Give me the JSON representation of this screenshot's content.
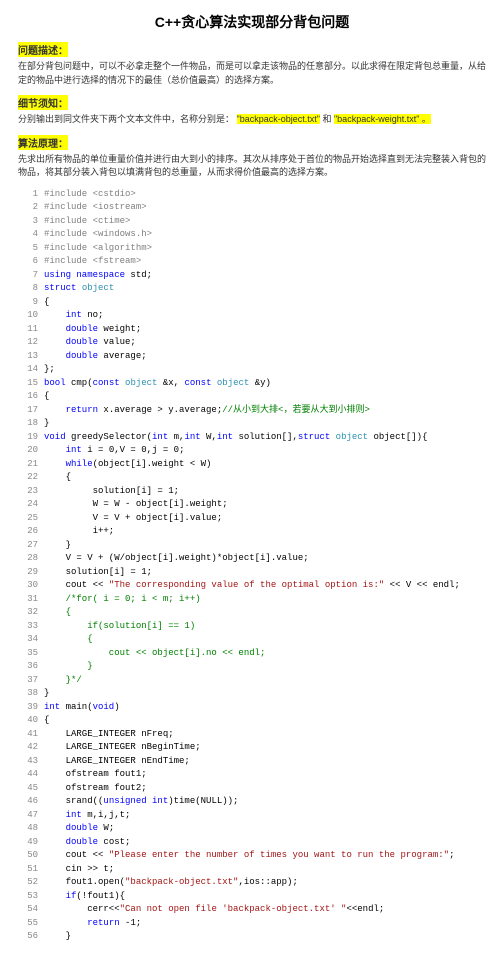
{
  "title": "C++贪心算法实现部分背包问题",
  "s1_h": "问题描述：",
  "s1_p": "在部分背包问题中，可以不必拿走整个一件物品，而是可以拿走该物品的任意部分。以此求得在限定背包总重量，从给定的物品中进行选择的情况下的最佳（总价值最高）的选择方案。",
  "s2_h": "细节须知：",
  "s2_p1": "分别输出到同文件夹下两个文本文件中，名称分别是：",
  "s2_hl1": "\"backpack-object.txt\"",
  "s2_mid": " 和 ",
  "s2_hl2": "\"backpack-weight.txt\" 。",
  "s3_h": "算法原理：",
  "s3_p": "先求出所有物品的单位重量价值并进行由大到小的排序。其次从排序处于首位的物品开始选择直到无法完整装入背包的物品，将其部分装入背包以填满背包的总重量，从而求得价值最高的选择方案。",
  "code": [
    {
      "n": "1",
      "c": [
        {
          "t": "#include <cstdio>",
          "k": "pp"
        }
      ]
    },
    {
      "n": "2",
      "c": [
        {
          "t": "#include <iostream>",
          "k": "pp"
        }
      ]
    },
    {
      "n": "3",
      "c": [
        {
          "t": "#include <ctime>",
          "k": "pp"
        }
      ]
    },
    {
      "n": "4",
      "c": [
        {
          "t": "#include <windows.h>",
          "k": "pp"
        }
      ]
    },
    {
      "n": "5",
      "c": [
        {
          "t": "#include <algorithm>",
          "k": "pp"
        }
      ]
    },
    {
      "n": "6",
      "c": [
        {
          "t": "#include <fstream>",
          "k": "pp"
        }
      ]
    },
    {
      "n": "7",
      "c": [
        {
          "t": "using namespace",
          "k": "kw"
        },
        {
          "t": " std;",
          "k": "id"
        }
      ]
    },
    {
      "n": "8",
      "c": [
        {
          "t": "struct",
          "k": "kw"
        },
        {
          "t": " ",
          "k": "id"
        },
        {
          "t": "object",
          "k": "tp"
        }
      ]
    },
    {
      "n": "9",
      "c": [
        {
          "t": "{",
          "k": "id"
        }
      ]
    },
    {
      "n": "10",
      "c": [
        {
          "t": "    ",
          "k": "id"
        },
        {
          "t": "int",
          "k": "kw"
        },
        {
          "t": " no;",
          "k": "id"
        }
      ]
    },
    {
      "n": "11",
      "c": [
        {
          "t": "    ",
          "k": "id"
        },
        {
          "t": "double",
          "k": "kw"
        },
        {
          "t": " weight;",
          "k": "id"
        }
      ]
    },
    {
      "n": "12",
      "c": [
        {
          "t": "    ",
          "k": "id"
        },
        {
          "t": "double",
          "k": "kw"
        },
        {
          "t": " value;",
          "k": "id"
        }
      ]
    },
    {
      "n": "13",
      "c": [
        {
          "t": "    ",
          "k": "id"
        },
        {
          "t": "double",
          "k": "kw"
        },
        {
          "t": " average;",
          "k": "id"
        }
      ]
    },
    {
      "n": "14",
      "c": [
        {
          "t": "};",
          "k": "id"
        }
      ]
    },
    {
      "n": "15",
      "c": [
        {
          "t": "bool",
          "k": "kw"
        },
        {
          "t": " cmp(",
          "k": "id"
        },
        {
          "t": "const",
          "k": "kw"
        },
        {
          "t": " ",
          "k": "id"
        },
        {
          "t": "object",
          "k": "tp"
        },
        {
          "t": " &x, ",
          "k": "id"
        },
        {
          "t": "const",
          "k": "kw"
        },
        {
          "t": " ",
          "k": "id"
        },
        {
          "t": "object",
          "k": "tp"
        },
        {
          "t": " &y)",
          "k": "id"
        }
      ]
    },
    {
      "n": "16",
      "c": [
        {
          "t": "{",
          "k": "id"
        }
      ]
    },
    {
      "n": "17",
      "c": [
        {
          "t": "    ",
          "k": "id"
        },
        {
          "t": "return",
          "k": "kw"
        },
        {
          "t": " x.average > y.average;",
          "k": "id"
        },
        {
          "t": "//从小到大排<，若要从大到小排则>",
          "k": "cm"
        }
      ]
    },
    {
      "n": "18",
      "c": [
        {
          "t": "}",
          "k": "id"
        }
      ]
    },
    {
      "n": "19",
      "c": [
        {
          "t": "void",
          "k": "kw"
        },
        {
          "t": " greedySelector(",
          "k": "id"
        },
        {
          "t": "int",
          "k": "kw"
        },
        {
          "t": " m,",
          "k": "id"
        },
        {
          "t": "int",
          "k": "kw"
        },
        {
          "t": " W,",
          "k": "id"
        },
        {
          "t": "int",
          "k": "kw"
        },
        {
          "t": " solution[],",
          "k": "id"
        },
        {
          "t": "struct",
          "k": "kw"
        },
        {
          "t": " ",
          "k": "id"
        },
        {
          "t": "object",
          "k": "tp"
        },
        {
          "t": " object[]){",
          "k": "id"
        }
      ]
    },
    {
      "n": "20",
      "c": [
        {
          "t": "    ",
          "k": "id"
        },
        {
          "t": "int",
          "k": "kw"
        },
        {
          "t": " i = ",
          "k": "id"
        },
        {
          "t": "0",
          "k": "num"
        },
        {
          "t": ",V = ",
          "k": "id"
        },
        {
          "t": "0",
          "k": "num"
        },
        {
          "t": ",j = ",
          "k": "id"
        },
        {
          "t": "0",
          "k": "num"
        },
        {
          "t": ";",
          "k": "id"
        }
      ]
    },
    {
      "n": "21",
      "c": [
        {
          "t": "    ",
          "k": "id"
        },
        {
          "t": "while",
          "k": "kw"
        },
        {
          "t": "(object[i].weight < W)",
          "k": "id"
        }
      ]
    },
    {
      "n": "22",
      "c": [
        {
          "t": "    {",
          "k": "id"
        }
      ]
    },
    {
      "n": "23",
      "c": [
        {
          "t": "         solution[i] = ",
          "k": "id"
        },
        {
          "t": "1",
          "k": "num"
        },
        {
          "t": ";",
          "k": "id"
        }
      ]
    },
    {
      "n": "24",
      "c": [
        {
          "t": "         W = W - object[i].weight;",
          "k": "id"
        }
      ]
    },
    {
      "n": "25",
      "c": [
        {
          "t": "         V = V + object[i].value;",
          "k": "id"
        }
      ]
    },
    {
      "n": "26",
      "c": [
        {
          "t": "         i++;",
          "k": "id"
        }
      ]
    },
    {
      "n": "27",
      "c": [
        {
          "t": "    }",
          "k": "id"
        }
      ]
    },
    {
      "n": "28",
      "c": [
        {
          "t": "    V = V + (W/object[i].weight)*object[i].value;",
          "k": "id"
        }
      ]
    },
    {
      "n": "29",
      "c": [
        {
          "t": "    solution[i] = ",
          "k": "id"
        },
        {
          "t": "1",
          "k": "num"
        },
        {
          "t": ";",
          "k": "id"
        }
      ]
    },
    {
      "n": "30",
      "c": [
        {
          "t": "    cout << ",
          "k": "id"
        },
        {
          "t": "\"The corresponding value of the optimal option is:\"",
          "k": "str"
        },
        {
          "t": " << V << endl;",
          "k": "id"
        }
      ]
    },
    {
      "n": "31",
      "c": [
        {
          "t": "    ",
          "k": "id"
        },
        {
          "t": "/*for( i = 0; i < m; i++)",
          "k": "cm"
        }
      ]
    },
    {
      "n": "32",
      "c": [
        {
          "t": "    {",
          "k": "cm"
        }
      ]
    },
    {
      "n": "33",
      "c": [
        {
          "t": "        if(solution[i] == 1)",
          "k": "cm"
        }
      ]
    },
    {
      "n": "34",
      "c": [
        {
          "t": "        {",
          "k": "cm"
        }
      ]
    },
    {
      "n": "35",
      "c": [
        {
          "t": "            cout << object[i].no << endl;",
          "k": "cm"
        }
      ]
    },
    {
      "n": "36",
      "c": [
        {
          "t": "        }",
          "k": "cm"
        }
      ]
    },
    {
      "n": "37",
      "c": [
        {
          "t": "    }*/",
          "k": "cm"
        }
      ]
    },
    {
      "n": "38",
      "c": [
        {
          "t": "}",
          "k": "id"
        }
      ]
    },
    {
      "n": "39",
      "c": [
        {
          "t": "int",
          "k": "kw"
        },
        {
          "t": " main(",
          "k": "id"
        },
        {
          "t": "void",
          "k": "kw"
        },
        {
          "t": ")",
          "k": "id"
        }
      ]
    },
    {
      "n": "40",
      "c": [
        {
          "t": "{",
          "k": "id"
        }
      ]
    },
    {
      "n": "41",
      "c": [
        {
          "t": "    LARGE_INTEGER nFreq;",
          "k": "id"
        }
      ]
    },
    {
      "n": "42",
      "c": [
        {
          "t": "    LARGE_INTEGER nBeginTime;",
          "k": "id"
        }
      ]
    },
    {
      "n": "43",
      "c": [
        {
          "t": "    LARGE_INTEGER nEndTime;",
          "k": "id"
        }
      ]
    },
    {
      "n": "44",
      "c": [
        {
          "t": "    ofstream fout1;",
          "k": "id"
        }
      ]
    },
    {
      "n": "45",
      "c": [
        {
          "t": "    ofstream fout2;",
          "k": "id"
        }
      ]
    },
    {
      "n": "46",
      "c": [
        {
          "t": "    srand((",
          "k": "id"
        },
        {
          "t": "unsigned int",
          "k": "kw"
        },
        {
          "t": ")time(NULL));",
          "k": "id"
        }
      ]
    },
    {
      "n": "47",
      "c": [
        {
          "t": "    ",
          "k": "id"
        },
        {
          "t": "int",
          "k": "kw"
        },
        {
          "t": " m,i,j,t;",
          "k": "id"
        }
      ]
    },
    {
      "n": "48",
      "c": [
        {
          "t": "    ",
          "k": "id"
        },
        {
          "t": "double",
          "k": "kw"
        },
        {
          "t": " W;",
          "k": "id"
        }
      ]
    },
    {
      "n": "49",
      "c": [
        {
          "t": "    ",
          "k": "id"
        },
        {
          "t": "double",
          "k": "kw"
        },
        {
          "t": " cost;",
          "k": "id"
        }
      ]
    },
    {
      "n": "50",
      "c": [
        {
          "t": "    cout << ",
          "k": "id"
        },
        {
          "t": "\"Please enter the number of times you want to run the program:\"",
          "k": "str"
        },
        {
          "t": ";",
          "k": "id"
        }
      ]
    },
    {
      "n": "51",
      "c": [
        {
          "t": "    cin >> t;",
          "k": "id"
        }
      ]
    },
    {
      "n": "52",
      "c": [
        {
          "t": "    fout1.open(",
          "k": "id"
        },
        {
          "t": "\"backpack-object.txt\"",
          "k": "str"
        },
        {
          "t": ",ios::app);",
          "k": "id"
        }
      ]
    },
    {
      "n": "53",
      "c": [
        {
          "t": "    ",
          "k": "id"
        },
        {
          "t": "if",
          "k": "kw"
        },
        {
          "t": "(!fout1){",
          "k": "id"
        }
      ]
    },
    {
      "n": "54",
      "c": [
        {
          "t": "        cerr<<",
          "k": "id"
        },
        {
          "t": "\"Can not open file 'backpack-object.txt' \"",
          "k": "str"
        },
        {
          "t": "<<endl;",
          "k": "id"
        }
      ]
    },
    {
      "n": "55",
      "c": [
        {
          "t": "        ",
          "k": "id"
        },
        {
          "t": "return",
          "k": "kw"
        },
        {
          "t": " -",
          "k": "id"
        },
        {
          "t": "1",
          "k": "num"
        },
        {
          "t": ";",
          "k": "id"
        }
      ]
    },
    {
      "n": "56",
      "c": [
        {
          "t": "    }",
          "k": "id"
        }
      ]
    }
  ]
}
